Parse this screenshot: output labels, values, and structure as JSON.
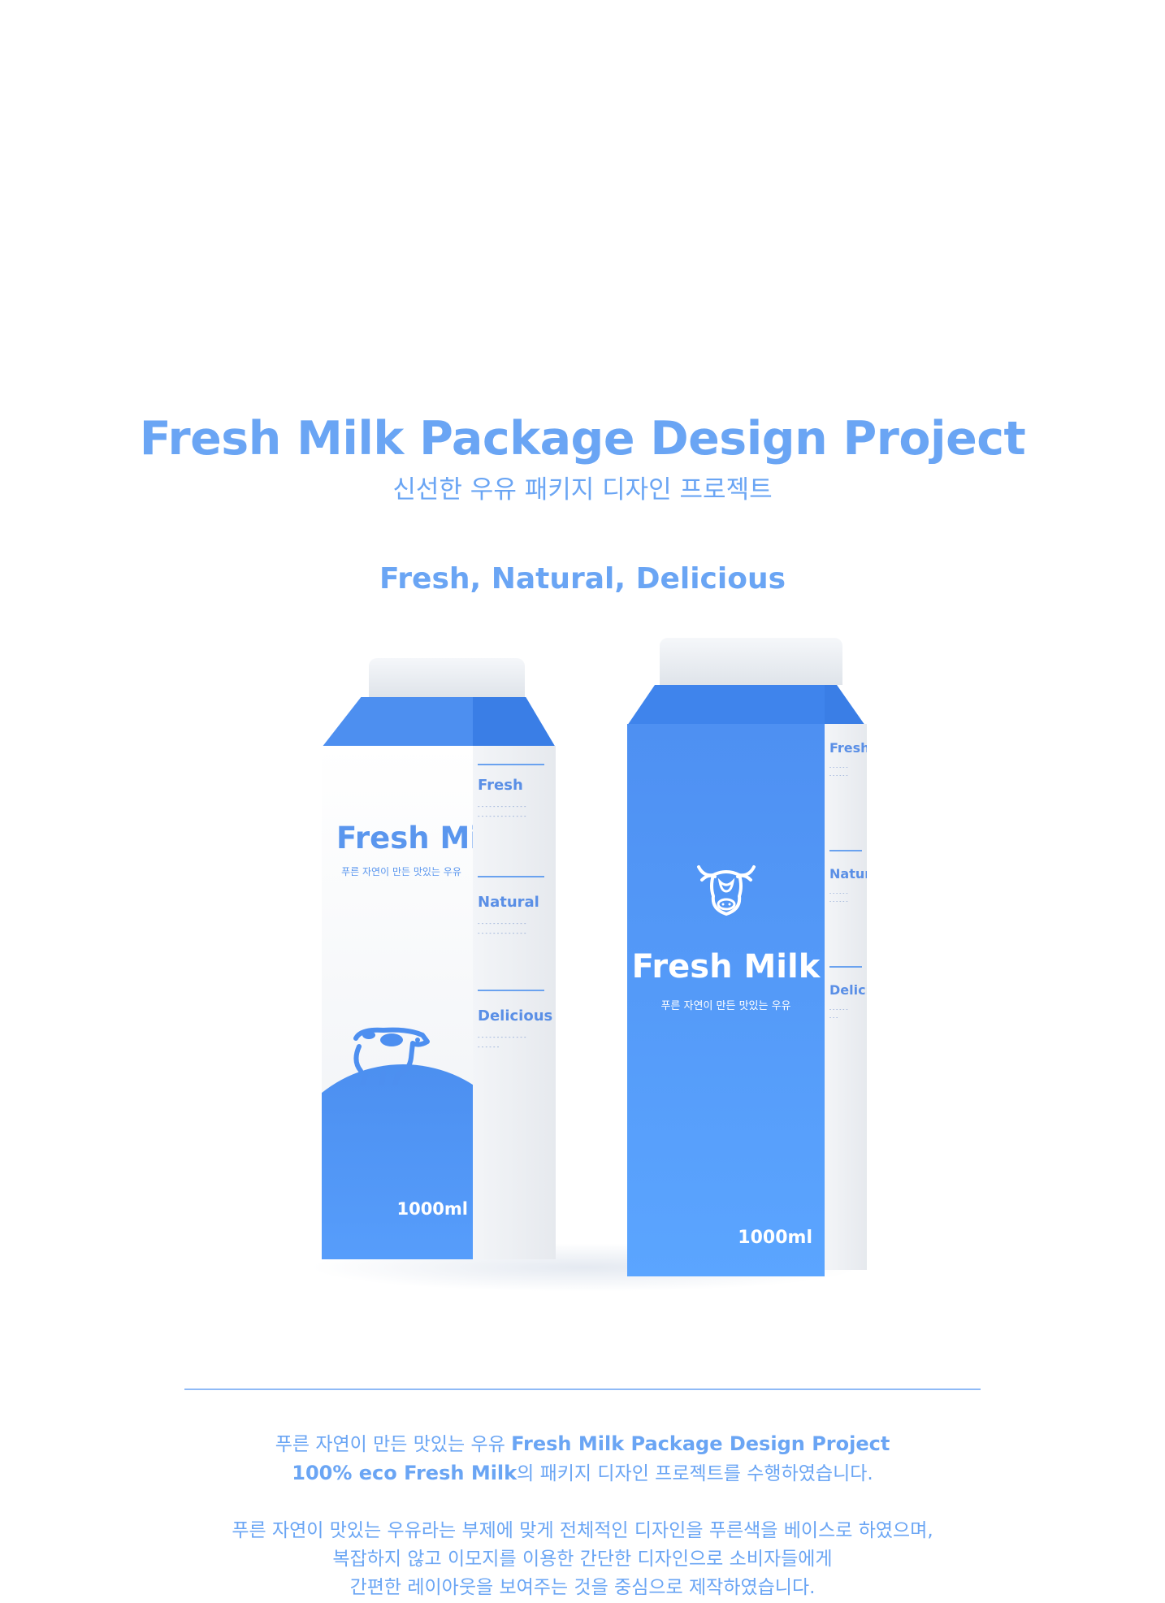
{
  "header": {
    "title": "Fresh Milk Package Design Project",
    "subtitle_ko": "신선한 우유 패키지 디자인 프로젝트",
    "tagline": "Fresh, Natural, Delicious"
  },
  "carton_white": {
    "brand": "Fresh Milk",
    "slogan": "푸른 자연이 만든 맛있는 우유",
    "volume": "1000ml",
    "side_sections": [
      {
        "heading": "Fresh"
      },
      {
        "heading": "Natural"
      },
      {
        "heading": "Delicious"
      }
    ]
  },
  "carton_blue": {
    "brand": "Fresh Milk",
    "slogan": "푸른 자연이 만든 맛있는 우유",
    "volume": "1000ml",
    "side_sections": [
      {
        "heading": "Fresh"
      },
      {
        "heading": "Natural"
      },
      {
        "heading": "Delicious"
      }
    ]
  },
  "description": {
    "line1_ko": "푸른 자연이 만든 맛있는 우유 ",
    "line1_bold": "Fresh Milk Package Design Project",
    "line2_bold": "100% eco Fresh Milk",
    "line2_ko": "의 패키지 디자인 프로젝트를 수행하였습니다.",
    "line3": "푸른 자연이 맛있는 우유라는 부제에 맞게 전체적인 디자인을 푸른색을 베이스로 하였으며,",
    "line4": "복잡하지 않고 이모지를 이용한 간단한 디자인으로 소비자들에게",
    "line5": "간편한 레이아웃을 보여주는 것을 중심으로 제작하였습니다."
  },
  "colors": {
    "accent": "#6aa5f4",
    "carton_blue": "#4e90f2",
    "white": "#ffffff"
  },
  "icons": [
    "cow-face-icon",
    "cow-sticker-icon"
  ]
}
